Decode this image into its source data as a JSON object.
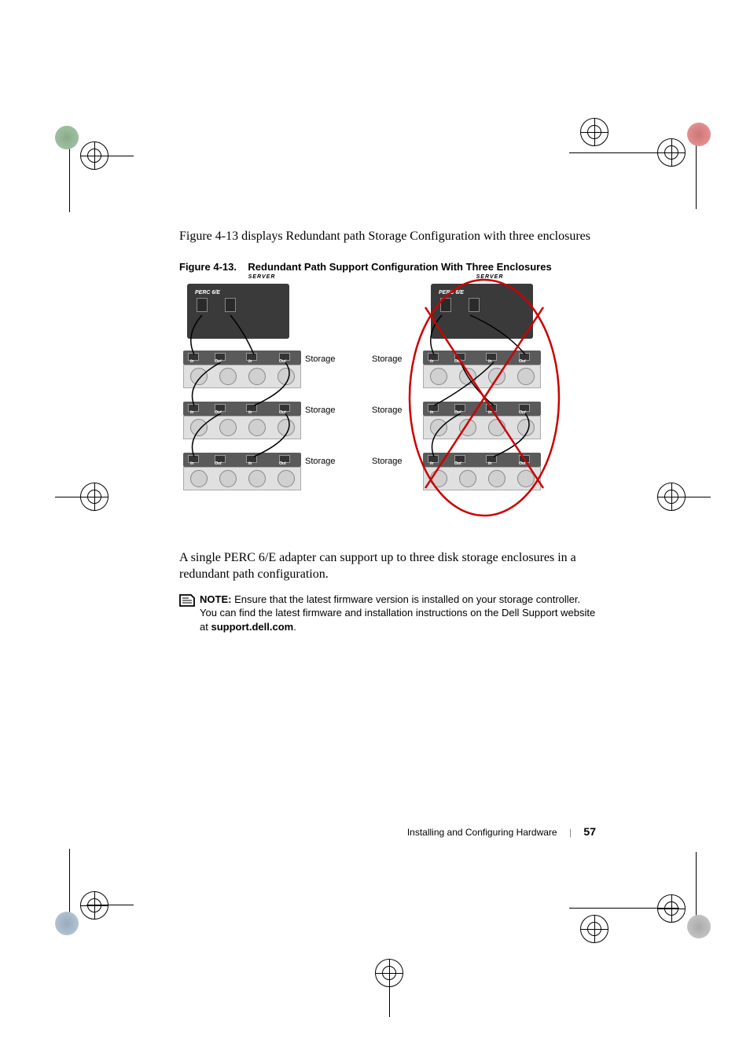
{
  "intro": "Figure 4-13 displays Redundant path Storage Configuration with three enclosures",
  "figure": {
    "caption_prefix": "Figure 4-13.",
    "caption": "Redundant Path Support Configuration With Three Enclosures",
    "server_label": "SERVER",
    "perc_label": "PERC 6/E",
    "port_in": "In",
    "port_out": "Out",
    "storage_label": "Storage"
  },
  "followup": "A single PERC 6/E adapter can support up to three disk storage enclosures in a redundant path configuration.",
  "note": {
    "label": "NOTE:",
    "body_pre": " Ensure that the latest firmware version is installed on your storage controller. You can find the latest firmware and installation instructions on the Dell Support website at ",
    "bold": "support.dell.com",
    "body_post": "."
  },
  "footer": {
    "section": "Installing and Configuring Hardware",
    "page": "57"
  }
}
